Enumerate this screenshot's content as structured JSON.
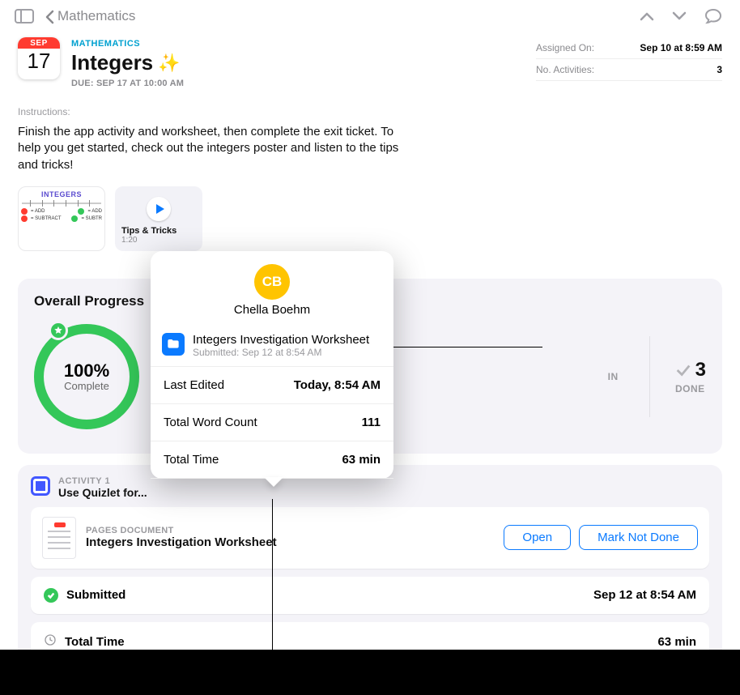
{
  "nav": {
    "back_label": "Mathematics"
  },
  "header": {
    "calendar_month": "SEP",
    "calendar_day": "17",
    "subject": "MATHEMATICS",
    "title": "Integers",
    "due": "DUE: SEP 17 AT 10:00 AM"
  },
  "meta": {
    "assigned_label": "Assigned On:",
    "assigned_value": "Sep 10 at 8:59 AM",
    "activities_label": "No. Activities:",
    "activities_value": "3"
  },
  "instructions": {
    "label": "Instructions:",
    "text": "Finish the app activity and worksheet, then complete the exit ticket. To help you get started, check out the integers poster and listen to the tips and tricks!"
  },
  "attachments": {
    "poster_title": "INTEGERS",
    "media_title": "Tips & Tricks",
    "media_duration": "1:20"
  },
  "progress": {
    "panel_title": "Overall Progress",
    "percent": "100%",
    "complete_label": "Complete",
    "min_label": "IN",
    "done_count": "3",
    "done_label": "DONE"
  },
  "activity1": {
    "label": "ACTIVITY 1",
    "title": "Use Quizlet for...",
    "doc_type": "PAGES DOCUMENT",
    "doc_name": "Integers Investigation Worksheet",
    "open_btn": "Open",
    "mark_btn": "Mark Not Done",
    "submitted_label": "Submitted",
    "submitted_value": "Sep 12 at 8:54 AM",
    "time_label": "Total Time",
    "time_value": "63 min"
  },
  "popover": {
    "initials": "CB",
    "name": "Chella Boehm",
    "file_title": "Integers Investigation Worksheet",
    "file_sub": "Submitted: Sep 12 at 8:54 AM",
    "row1_label": "Last Edited",
    "row1_value": "Today, 8:54 AM",
    "row2_label": "Total Word Count",
    "row2_value": "111",
    "row3_label": "Total Time",
    "row3_value": "63 min"
  }
}
